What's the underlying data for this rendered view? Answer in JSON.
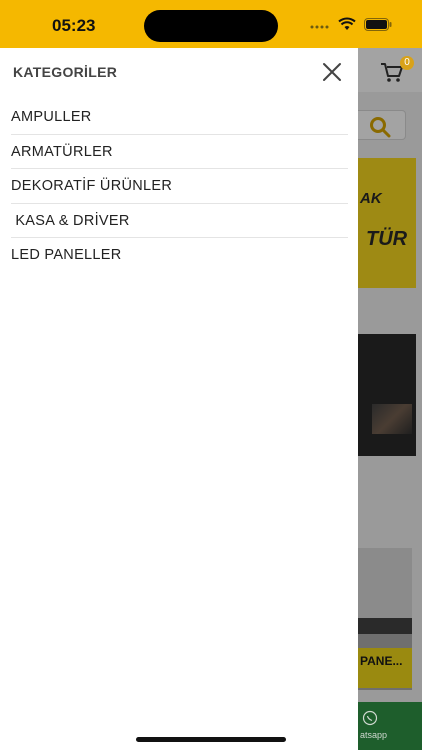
{
  "status_bar": {
    "time": "05:23"
  },
  "drawer": {
    "title": "KATEGORİLER",
    "categories": [
      {
        "label": "AMPULLER"
      },
      {
        "label": "ARMATÜRLER"
      },
      {
        "label": "DEKORATİF ÜRÜNLER"
      },
      {
        "label": " KASA & DRİVER"
      },
      {
        "label": "LED PANELLER"
      }
    ]
  },
  "background": {
    "cart_count": "0",
    "banner_text_1": "AK",
    "banner_text_2": "TÜR",
    "card_label": "PANE...",
    "whatsapp_label": "atsapp"
  },
  "colors": {
    "accent": "#f5b800",
    "overlay": "#9a9a9a"
  }
}
